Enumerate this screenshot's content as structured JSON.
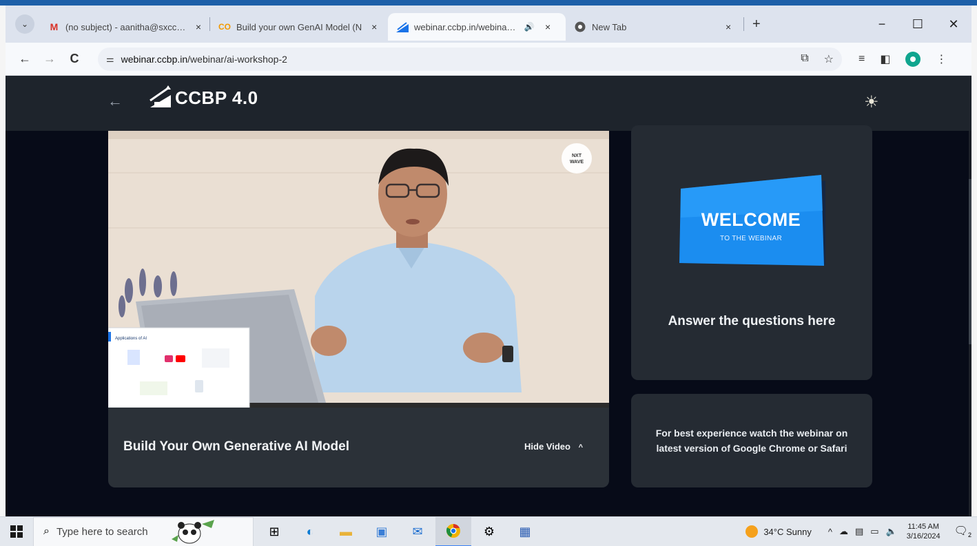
{
  "browser": {
    "tabs": [
      {
        "title": "(no subject) - aanitha@sxcce.co",
        "icon": "gmail-icon",
        "active": false
      },
      {
        "title": "Build your own GenAI Model (N",
        "icon": "colab-icon",
        "active": false
      },
      {
        "title": "webinar.ccbp.in/webinar/ai-",
        "icon": "ccbp-icon",
        "active": true
      },
      {
        "title": "New Tab",
        "icon": "chrome-icon",
        "active": false
      }
    ],
    "close_glyph": "×",
    "new_tab_glyph": "+",
    "minimize_glyph": "−",
    "maximize_glyph": "☐",
    "close_window_glyph": "✕",
    "back_glyph": "←",
    "forward_glyph": "→",
    "reload_glyph": "C",
    "url_domain": "webinar.ccbp.in",
    "url_path": "/webinar/ai-workshop-2",
    "site_info_glyph": "⚌",
    "tab_menu_glyph": "⌄"
  },
  "app": {
    "logo_text": "CCBP 4.0",
    "back_glyph": "←",
    "theme_glyph": "☀",
    "video": {
      "title": "Build Your Own Generative AI Model",
      "hide_label": "Hide Video",
      "hide_chevron": "^",
      "watermark": "NXT WAVE"
    },
    "welcome": {
      "title": "WELCOME",
      "subtitle": "TO THE WEBINAR",
      "cta": "Answer the questions here"
    },
    "info": "For best experience watch the webinar on latest version of Google Chrome or Safari"
  },
  "taskbar": {
    "search_placeholder": "Type here to search",
    "weather": "34°C  Sunny",
    "time": "11:45 AM",
    "date": "3/16/2024",
    "notifications": "2"
  },
  "colors": {
    "header_bg": "#1e242c",
    "card_bg": "#252b33",
    "welcome_blue": "#1a8ef0"
  }
}
